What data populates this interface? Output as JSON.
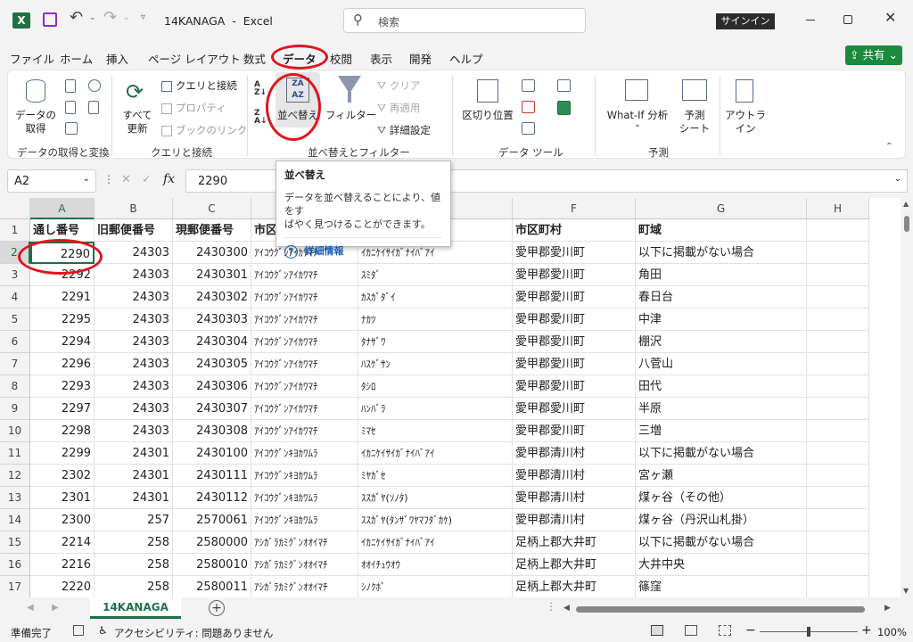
{
  "title_bar": {
    "filename": "14KANAGA",
    "app_sep": "-",
    "app": "Excel",
    "search_placeholder": "検索",
    "signin": "サインイン"
  },
  "menu": {
    "items": [
      "ファイル",
      "ホーム",
      "挿入",
      "ページ レイアウト",
      "数式",
      "データ",
      "校閲",
      "表示",
      "開発",
      "ヘルプ"
    ],
    "share": "共有"
  },
  "ribbon": {
    "get_data_l1": "データの",
    "get_data_l2": "取得",
    "group_get": "データの取得と変換",
    "refresh_l1": "すべて",
    "refresh_l2": "更新",
    "queries": "クエリと接続",
    "properties": "プロパティ",
    "links": "ブックのリンク",
    "group_queries": "クエリと接続",
    "sort": "並べ替え",
    "filter": "フィルター",
    "clear": "クリア",
    "reapply": "再適用",
    "advanced": "詳細設定",
    "group_sort": "並べ替えとフィルター",
    "text_to_columns": "区切り位置",
    "group_tools": "データ ツール",
    "whatif": "What-If 分析",
    "forecast_l1": "予測",
    "forecast_l2": "シート",
    "group_forecast": "予測",
    "outline_l1": "アウトラ",
    "outline_l2": "イン"
  },
  "tooltip": {
    "title": "並べ替え",
    "desc_l1": "データを並べ替えることにより、値をす",
    "desc_l2": "ばやく見つけることができます。",
    "link": "詳細情報"
  },
  "formula_bar": {
    "name_box": "A2",
    "fx": "fx",
    "value": "2290"
  },
  "grid": {
    "columns": [
      "A",
      "B",
      "C",
      "D",
      "E",
      "F",
      "G",
      "H"
    ],
    "row_numbers": [
      "1",
      "2",
      "3",
      "4",
      "5",
      "6",
      "7",
      "8",
      "9",
      "10",
      "11",
      "12",
      "13",
      "14",
      "15",
      "16",
      "17"
    ],
    "rows": [
      [
        "通し番号",
        "旧郵便番号",
        "現郵便番号",
        "市区町村ｶﾅ",
        "町域ｶﾅ",
        "市区町村",
        "町域"
      ],
      [
        "2290",
        "24303",
        "2430300",
        "ｱｲｺｳｸﾞﾝｱｲｶﾜﾏﾁ",
        "ｲｶﾆｹｲｻｲｶﾞﾅｲﾊﾞｱｲ",
        "愛甲郡愛川町",
        "以下に掲載がない場合"
      ],
      [
        "2292",
        "24303",
        "2430301",
        "ｱｲｺｳｸﾞﾝｱｲｶﾜﾏﾁ",
        "ｽﾐﾀﾞ",
        "愛甲郡愛川町",
        "角田"
      ],
      [
        "2291",
        "24303",
        "2430302",
        "ｱｲｺｳｸﾞﾝｱｲｶﾜﾏﾁ",
        "ｶｽｶﾞﾀﾞｲ",
        "愛甲郡愛川町",
        "春日台"
      ],
      [
        "2295",
        "24303",
        "2430303",
        "ｱｲｺｳｸﾞﾝｱｲｶﾜﾏﾁ",
        "ﾅｶﾂ",
        "愛甲郡愛川町",
        "中津"
      ],
      [
        "2294",
        "24303",
        "2430304",
        "ｱｲｺｳｸﾞﾝｱｲｶﾜﾏﾁ",
        "ﾀﾅｻﾞﾜ",
        "愛甲郡愛川町",
        "棚沢"
      ],
      [
        "2296",
        "24303",
        "2430305",
        "ｱｲｺｳｸﾞﾝｱｲｶﾜﾏﾁ",
        "ﾊｽｹﾞｻﾝ",
        "愛甲郡愛川町",
        "八菅山"
      ],
      [
        "2293",
        "24303",
        "2430306",
        "ｱｲｺｳｸﾞﾝｱｲｶﾜﾏﾁ",
        "ﾀｼﾛ",
        "愛甲郡愛川町",
        "田代"
      ],
      [
        "2297",
        "24303",
        "2430307",
        "ｱｲｺｳｸﾞﾝｱｲｶﾜﾏﾁ",
        "ﾊﾝﾊﾞﾗ",
        "愛甲郡愛川町",
        "半原"
      ],
      [
        "2298",
        "24303",
        "2430308",
        "ｱｲｺｳｸﾞﾝｱｲｶﾜﾏﾁ",
        "ﾐﾏｾ",
        "愛甲郡愛川町",
        "三増"
      ],
      [
        "2299",
        "24301",
        "2430100",
        "ｱｲｺｳｸﾞﾝｷﾖｶﾜﾑﾗ",
        "ｲｶﾆｹｲｻｲｶﾞﾅｲﾊﾞｱｲ",
        "愛甲郡清川村",
        "以下に掲載がない場合"
      ],
      [
        "2302",
        "24301",
        "2430111",
        "ｱｲｺｳｸﾞﾝｷﾖｶﾜﾑﾗ",
        "ﾐﾔｶﾞｾ",
        "愛甲郡清川村",
        "宮ヶ瀬"
      ],
      [
        "2301",
        "24301",
        "2430112",
        "ｱｲｺｳｸﾞﾝｷﾖｶﾜﾑﾗ",
        "ｽｽｶﾞﾔ(ｿﾉﾀ)",
        "愛甲郡清川村",
        "煤ヶ谷（その他）"
      ],
      [
        "2300",
        "257",
        "2570061",
        "ｱｲｺｳｸﾞﾝｷﾖｶﾜﾑﾗ",
        "ｽｽｶﾞﾔ(ﾀﾝｻﾞﾜﾔﾏﾌﾀﾞｶｹ)",
        "愛甲郡清川村",
        "煤ヶ谷（丹沢山札掛）"
      ],
      [
        "2214",
        "258",
        "2580000",
        "ｱｼｶﾞﾗｶﾐｸﾞﾝｵｵｲﾏﾁ",
        "ｲｶﾆｹｲｻｲｶﾞﾅｲﾊﾞｱｲ",
        "足柄上郡大井町",
        "以下に掲載がない場合"
      ],
      [
        "2216",
        "258",
        "2580010",
        "ｱｼｶﾞﾗｶﾐｸﾞﾝｵｵｲﾏﾁ",
        "ｵｵｲﾁｭｳｵｳ",
        "足柄上郡大井町",
        "大井中央"
      ],
      [
        "2220",
        "258",
        "2580011",
        "ｱｼｶﾞﾗｶﾐｸﾞﾝｵｵｲﾏﾁ",
        "ｼﾉｸﾎﾞ",
        "足柄上郡大井町",
        "篠窪"
      ]
    ]
  },
  "sheet_tab": "14KANAGA",
  "status": {
    "ready": "準備完了",
    "accessibility": "アクセシビリティ: 問題ありません",
    "zoom": "100%"
  },
  "colors": {
    "excel_green": "#1e7145",
    "share_green": "#1a8a3c",
    "annotation_red": "#e0141e",
    "link_blue": "#1a5fb4"
  }
}
